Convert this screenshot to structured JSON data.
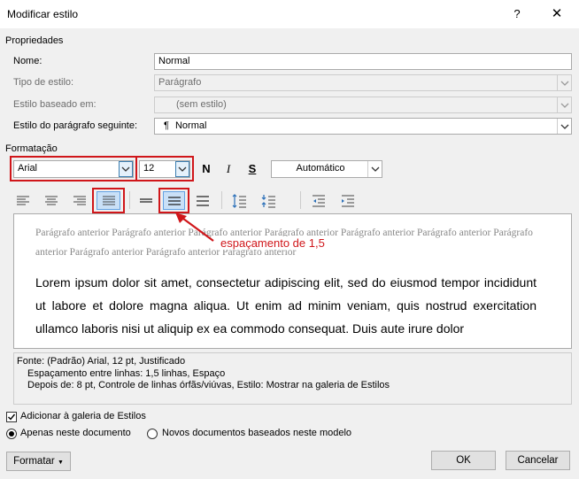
{
  "window": {
    "title": "Modificar estilo",
    "help_glyph": "?",
    "close_glyph": "✕"
  },
  "properties": {
    "section_label": "Propriedades",
    "name_label": "Nome:",
    "name_value": "Normal",
    "style_type_label": "Tipo de estilo:",
    "style_type_value": "Parágrafo",
    "based_on_label": "Estilo baseado em:",
    "based_on_value": "(sem estilo)",
    "next_style_label": "Estilo do parágrafo seguinte:",
    "next_style_value": "Normal",
    "next_style_icon": "¶"
  },
  "formatting": {
    "section_label": "Formatação",
    "font": "Arial",
    "size": "12",
    "bold": "N",
    "italic": "I",
    "underline": "S",
    "color": "Automático"
  },
  "annotation": {
    "text": "espaçamento de 1,5",
    "color": "#d0161a"
  },
  "preview": {
    "previous_paragraph": "Parágrafo anterior Parágrafo anterior Parágrafo anterior Parágrafo anterior Parágrafo anterior Parágrafo anterior Parágrafo anterior Parágrafo anterior Parágrafo anterior Parágrafo anterior",
    "main_text": "Lorem ipsum dolor sit amet, consectetur adipiscing elit, sed do eiusmod tempor incididunt ut labore et dolore magna aliqua. Ut enim ad minim veniam, quis nostrud exercitation ullamco laboris nisi ut aliquip ex ea commodo consequat. Duis aute irure dolor"
  },
  "description": {
    "line1": "Fonte: (Padrão) Arial, 12 pt, Justificado",
    "line2": "Espaçamento entre linhas:  1,5 linhas, Espaço",
    "line3": "Depois de:  8 pt, Controle de linhas órfãs/viúvas, Estilo: Mostrar na galeria de Estilos"
  },
  "options": {
    "add_gallery": "Adicionar à galeria de Estilos",
    "add_gallery_checked": true,
    "only_doc": "Apenas neste documento",
    "new_docs": "Novos documentos baseados neste modelo"
  },
  "buttons": {
    "format": "Formatar",
    "ok": "OK",
    "cancel": "Cancelar"
  }
}
